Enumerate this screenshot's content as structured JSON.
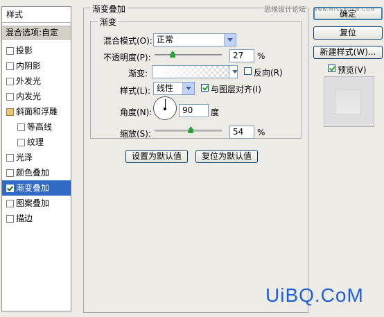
{
  "sidebar": {
    "title": "样式",
    "blend_options": "混合选项:自定",
    "items": [
      {
        "label": "投影",
        "checked": false,
        "kind": "check"
      },
      {
        "label": "内阴影",
        "checked": false,
        "kind": "check"
      },
      {
        "label": "外发光",
        "checked": false,
        "kind": "check"
      },
      {
        "label": "内发光",
        "checked": false,
        "kind": "check"
      },
      {
        "label": "斜面和浮雕",
        "checked": false,
        "kind": "folder"
      },
      {
        "label": "等高线",
        "checked": false,
        "kind": "sub"
      },
      {
        "label": "纹理",
        "checked": false,
        "kind": "sub"
      },
      {
        "label": "光泽",
        "checked": false,
        "kind": "check"
      },
      {
        "label": "颜色叠加",
        "checked": false,
        "kind": "check"
      },
      {
        "label": "渐变叠加",
        "checked": true,
        "kind": "check",
        "active": true
      },
      {
        "label": "图案叠加",
        "checked": false,
        "kind": "check"
      },
      {
        "label": "描边",
        "checked": false,
        "kind": "check"
      }
    ]
  },
  "panel": {
    "outer_title": "渐变叠加",
    "inner_title": "渐变",
    "blend_mode_label": "混合模式(O):",
    "blend_mode_value": "正常",
    "opacity_label": "不透明度(P):",
    "opacity_value": "27",
    "opacity_unit": "%",
    "opacity_fraction": 0.27,
    "gradient_label": "渐变:",
    "reverse_label": "反向(R)",
    "reverse_checked": false,
    "style_label": "样式(L):",
    "style_value": "线性",
    "align_label": "与图层对齐(I)",
    "align_checked": true,
    "angle_label": "角度(N):",
    "angle_value": "90",
    "angle_unit": "度",
    "scale_label": "缩放(S):",
    "scale_value": "54",
    "scale_unit": "%",
    "scale_fraction": 0.54,
    "set_default_button": "设置为默认值",
    "reset_default_button": "复位为默认值"
  },
  "right": {
    "ok_button": "确定",
    "reset_button": "复位",
    "new_style_button": "新建样式(W)...",
    "preview_label": "预览(V)",
    "preview_checked": true
  },
  "watermarks": {
    "top": "思缘设计论坛",
    "top_small": "www.MISSYUAN.COM",
    "bottom": "UiBQ.CoM"
  },
  "colors": {
    "selection": "#316ac5",
    "watermark_blue": "#1e5fd8"
  }
}
